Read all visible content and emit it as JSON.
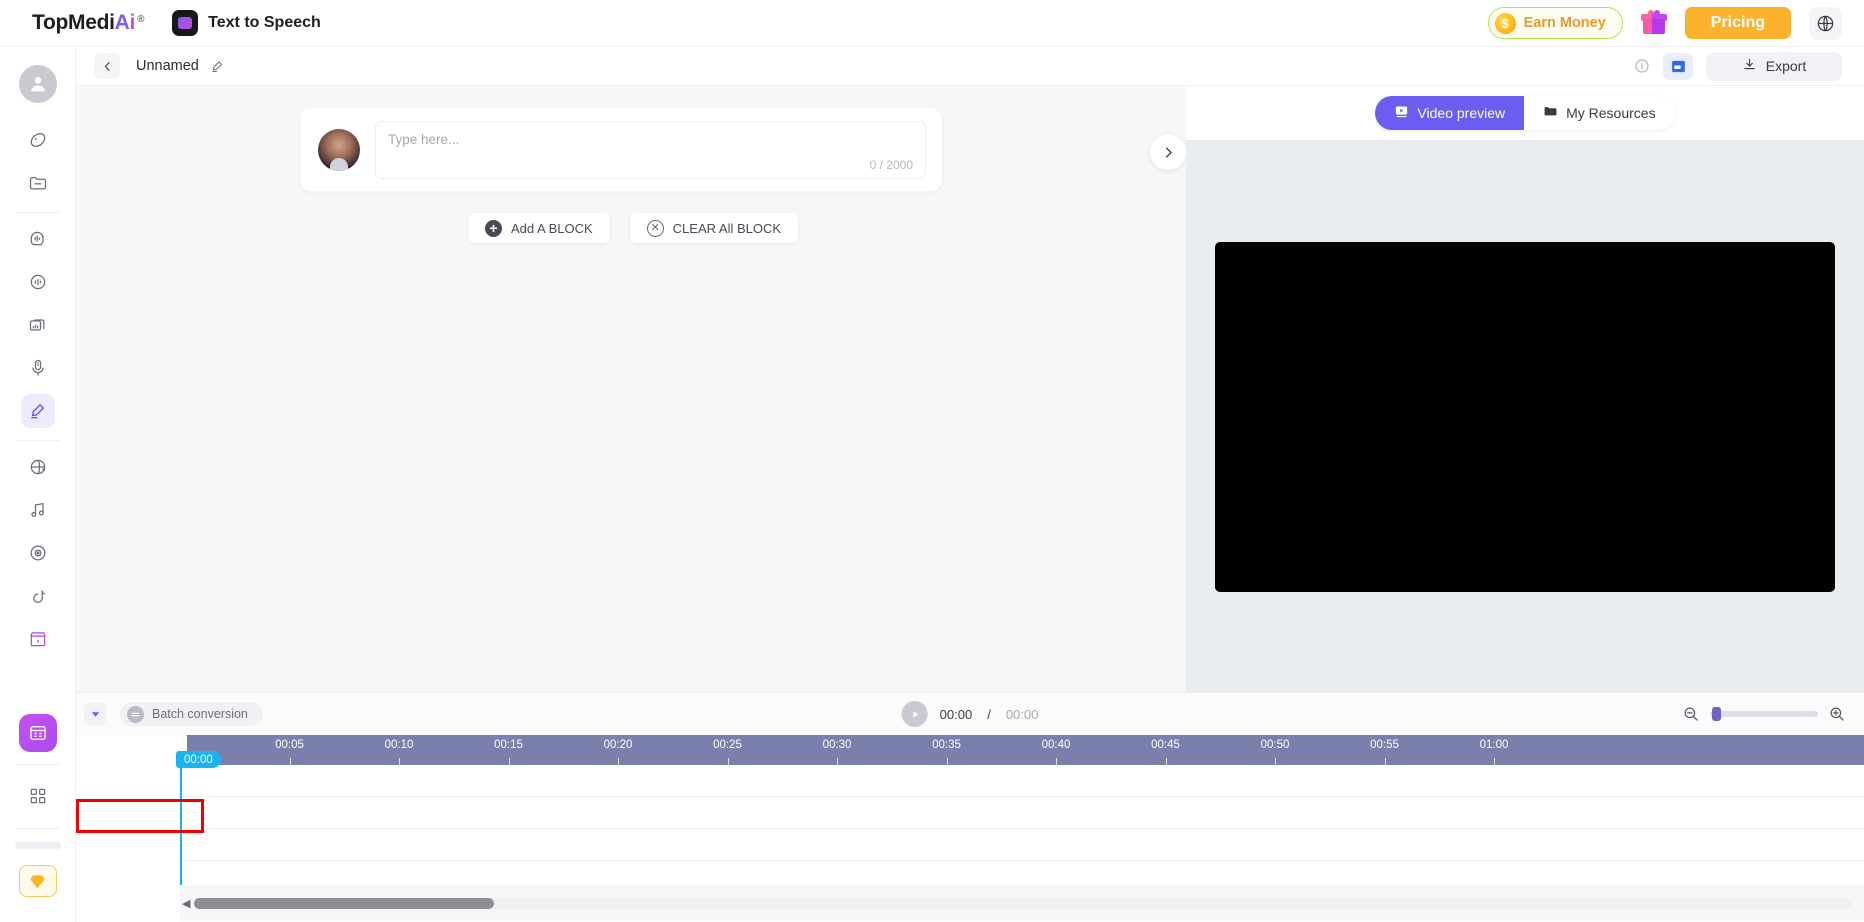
{
  "topbar": {
    "brand_part1": "TopMedi",
    "brand_part2": "A",
    "brand_part3": "i",
    "brand_reg": "®",
    "product_label": "Text to Speech",
    "earn_money_label": "Earn Money",
    "coin_symbol": "$",
    "pricing_label": "Pricing",
    "gift_icon": "gift-icon",
    "globe_icon": "globe-icon"
  },
  "sidebar": {
    "avatar": "user-avatar-icon",
    "items": [
      {
        "name": "voice-cloning-icon"
      },
      {
        "name": "folder-icon"
      },
      {
        "name": "voice-changer-icon"
      },
      {
        "name": "audio-enhance-icon"
      },
      {
        "name": "multi-track-icon"
      },
      {
        "name": "microphone-icon"
      },
      {
        "name": "text-to-speech-icon",
        "active": true
      },
      {
        "name": "globe-voice-icon"
      },
      {
        "name": "music-icon"
      },
      {
        "name": "vinyl-icon"
      },
      {
        "name": "tiktok-icon"
      },
      {
        "name": "store-icon"
      }
    ],
    "feature_tile": "video-editor-tile-icon",
    "apps_grid": "apps-grid-icon",
    "diamond": "diamond-upgrade-icon"
  },
  "project_header": {
    "back_icon": "chevron-left-icon",
    "project_name": "Unnamed",
    "edit_icon": "pencil-edit-icon",
    "info_icon": "info-icon",
    "save_icon": "save-icon",
    "export_label": "Export",
    "export_icon": "download-icon"
  },
  "editor": {
    "block": {
      "avatar": "speaker-avatar",
      "input_placeholder": "Type here...",
      "char_count": "0 / 2000"
    },
    "add_block_label": "Add A BLOCK",
    "clear_block_label": "CLEAR All BLOCK",
    "collapse_icon": "chevron-right-icon"
  },
  "preview": {
    "tabs": [
      {
        "label": "Video preview",
        "icon": "play-rect-icon",
        "active": true
      },
      {
        "label": "My Resources",
        "icon": "folder-icon",
        "active": false
      }
    ]
  },
  "timeline": {
    "caret_icon": "caret-down-icon",
    "batch_label": "Batch conversion",
    "batch_icon": "batch-convert-icon",
    "play_icon": "play-icon",
    "current_time": "00:00",
    "time_separator": "/",
    "total_time": "00:00",
    "zoom_out_icon": "zoom-out-icon",
    "zoom_in_icon": "zoom-in-icon",
    "playhead_time": "00:00",
    "ruler_ticks": [
      "00:05",
      "00:10",
      "00:15",
      "00:20",
      "00:25",
      "00:30",
      "00:35",
      "00:40",
      "00:45",
      "00:50",
      "00:55",
      "01:00"
    ],
    "tracks": [
      {
        "type_icon": "microphone-track-icon",
        "eye_icon": "eye-icon",
        "audio_icon": "speaker-on-icon",
        "add_icon": "plus-icon",
        "highlighted": false
      },
      {
        "type_icon": "video-camera-track-icon",
        "eye_icon": "eye-icon",
        "audio_icon": "muted-placeholder",
        "add_icon": "plus-icon",
        "highlighted": true
      },
      {
        "type_icon": "music-track-icon",
        "eye_icon": "eye-icon",
        "audio_icon": "speaker-on-icon",
        "add_icon": "plus-icon",
        "highlighted": false
      }
    ],
    "scroll_left_icon": "scroll-left-arrow"
  },
  "colors": {
    "accent_purple": "#6a5df0",
    "brand_orange": "#fbb22c",
    "playhead_blue": "#19b4ef",
    "ruler_purple": "#7b7fac",
    "highlight_red": "#f10000"
  }
}
